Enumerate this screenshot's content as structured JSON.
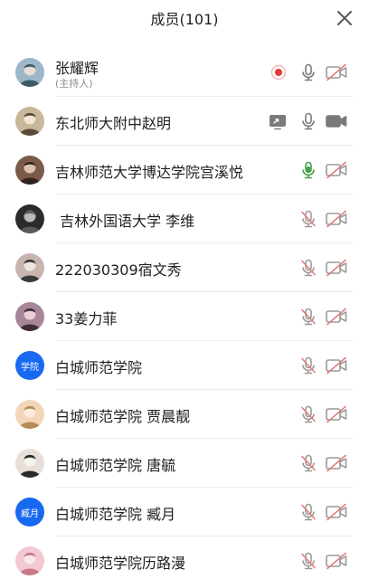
{
  "header": {
    "title": "成员(101)",
    "close_icon": "close-icon"
  },
  "colors": {
    "accent": "#1769f2",
    "muted_red": "#e27c7c",
    "recording_red": "#e53935",
    "mic_green": "#43a047",
    "icon_gray": "#7a7a7a"
  },
  "members": [
    {
      "name": "张耀辉",
      "sub": "(主持人)",
      "avatar": "photo",
      "recording": true,
      "mic": "on",
      "camera": "off"
    },
    {
      "name": "东北师大附中赵明",
      "avatar": "photo",
      "sharing": true,
      "mic": "on",
      "camera": "on"
    },
    {
      "name": "吉林师范大学博达学院宫溪悦",
      "avatar": "photo",
      "mic": "speaking",
      "camera": "off"
    },
    {
      "name": " 吉林外国语大学 李维",
      "avatar": "photo",
      "mic": "muted",
      "camera": "off"
    },
    {
      "name": "222030309宿文秀",
      "avatar": "photo",
      "mic": "muted",
      "camera": "off"
    },
    {
      "name": "33姜力菲",
      "avatar": "photo",
      "mic": "muted",
      "camera": "off"
    },
    {
      "name": "白城师范学院",
      "avatar": "text",
      "avatar_text": "学院",
      "mic": "muted",
      "camera": "off"
    },
    {
      "name": "白城师范学院 贾晨靓",
      "avatar": "photo",
      "mic": "muted",
      "camera": "off"
    },
    {
      "name": "白城师范学院 唐毓",
      "avatar": "photo",
      "mic": "muted",
      "camera": "off"
    },
    {
      "name": "白城师范学院 臧月",
      "avatar": "text",
      "avatar_text": "臧月",
      "mic": "muted",
      "camera": "off"
    },
    {
      "name": "白城师范学院历路漫",
      "avatar": "photo",
      "mic": "muted",
      "camera": "off"
    }
  ]
}
